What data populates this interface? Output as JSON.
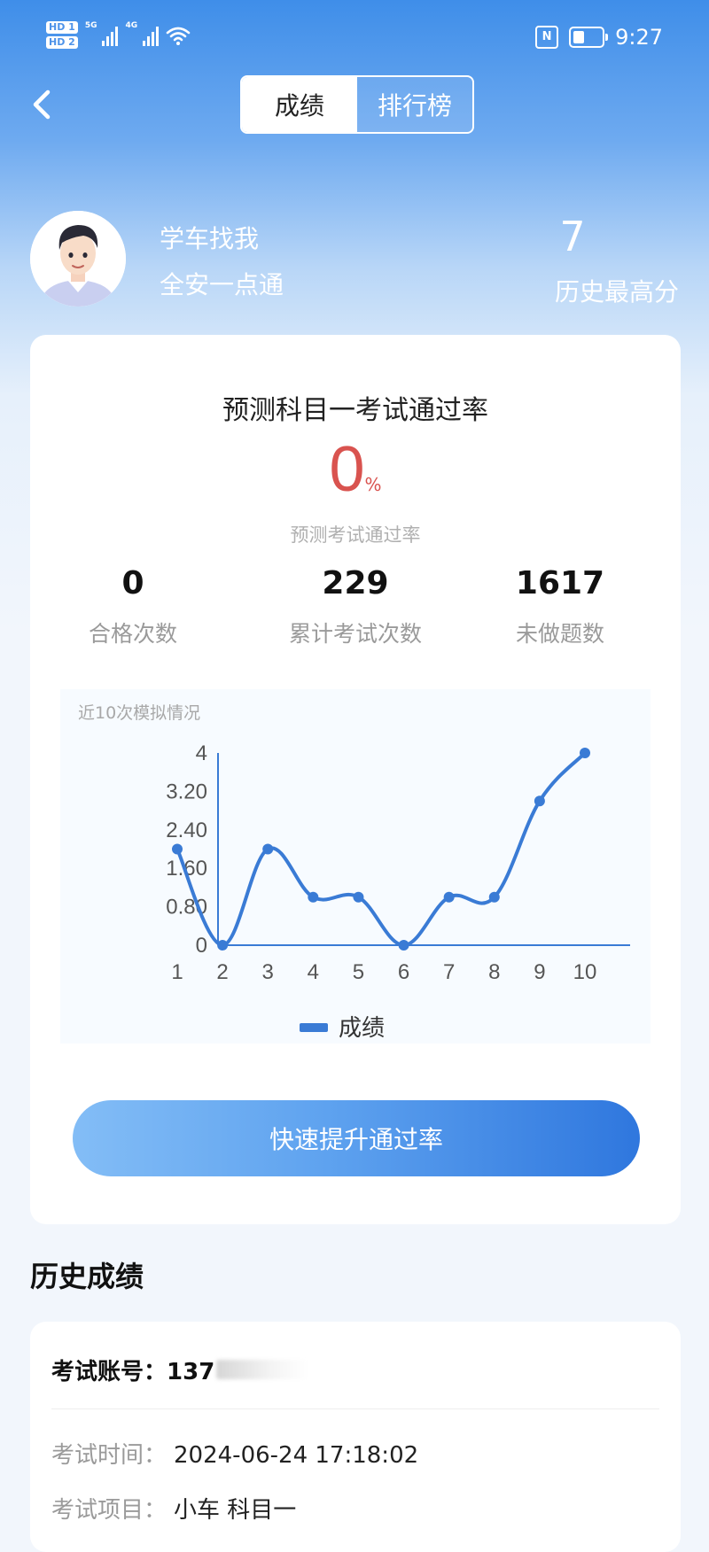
{
  "status_bar": {
    "hd1": "HD 1",
    "hd2": "HD 2",
    "net1": "5G",
    "net2": "4G",
    "time": "9:27",
    "battery_level": 0.4,
    "nfc": "N"
  },
  "header": {
    "tabs": [
      {
        "label": "成绩",
        "active": true
      },
      {
        "label": "排行榜",
        "active": false
      }
    ]
  },
  "profile": {
    "line1": "学车找我",
    "line2": "全安一点通",
    "best_score": "7",
    "best_label": "历史最高分"
  },
  "card": {
    "title": "预测科目一考试通过率",
    "rate_value": "0",
    "rate_unit": "%",
    "rate_label": "预测考试通过率",
    "stats": [
      {
        "value": "0",
        "label": "合格次数"
      },
      {
        "value": "229",
        "label": "累计考试次数"
      },
      {
        "value": "1617",
        "label": "未做题数"
      }
    ],
    "chart_caption": "近10次模拟情况",
    "cta_label": "快速提升通过率"
  },
  "chart_data": {
    "type": "line",
    "title": "近10次模拟情况",
    "x": [
      1,
      2,
      3,
      4,
      5,
      6,
      7,
      8,
      9,
      10
    ],
    "series": [
      {
        "name": "成绩",
        "values": [
          2,
          0,
          2,
          1,
          1,
          0,
          1,
          1,
          3,
          4
        ]
      }
    ],
    "yticks": [
      "0",
      "0.80",
      "1.60",
      "2.40",
      "3.20",
      "4"
    ],
    "ylim": [
      0,
      4
    ],
    "legend": "bottom-center",
    "smooth": true,
    "color": "#3a7bd5",
    "grid": false
  },
  "history": {
    "title": "历史成绩",
    "account_label": "考试账号：",
    "account_value": "137",
    "time_label": "考试时间：",
    "time_value": "2024-06-24 17:18:02",
    "item_label": "考试项目：",
    "item_value": "小车 科目一"
  },
  "colors": {
    "accent": "#3a7bd5",
    "rate": "#d9534f"
  }
}
